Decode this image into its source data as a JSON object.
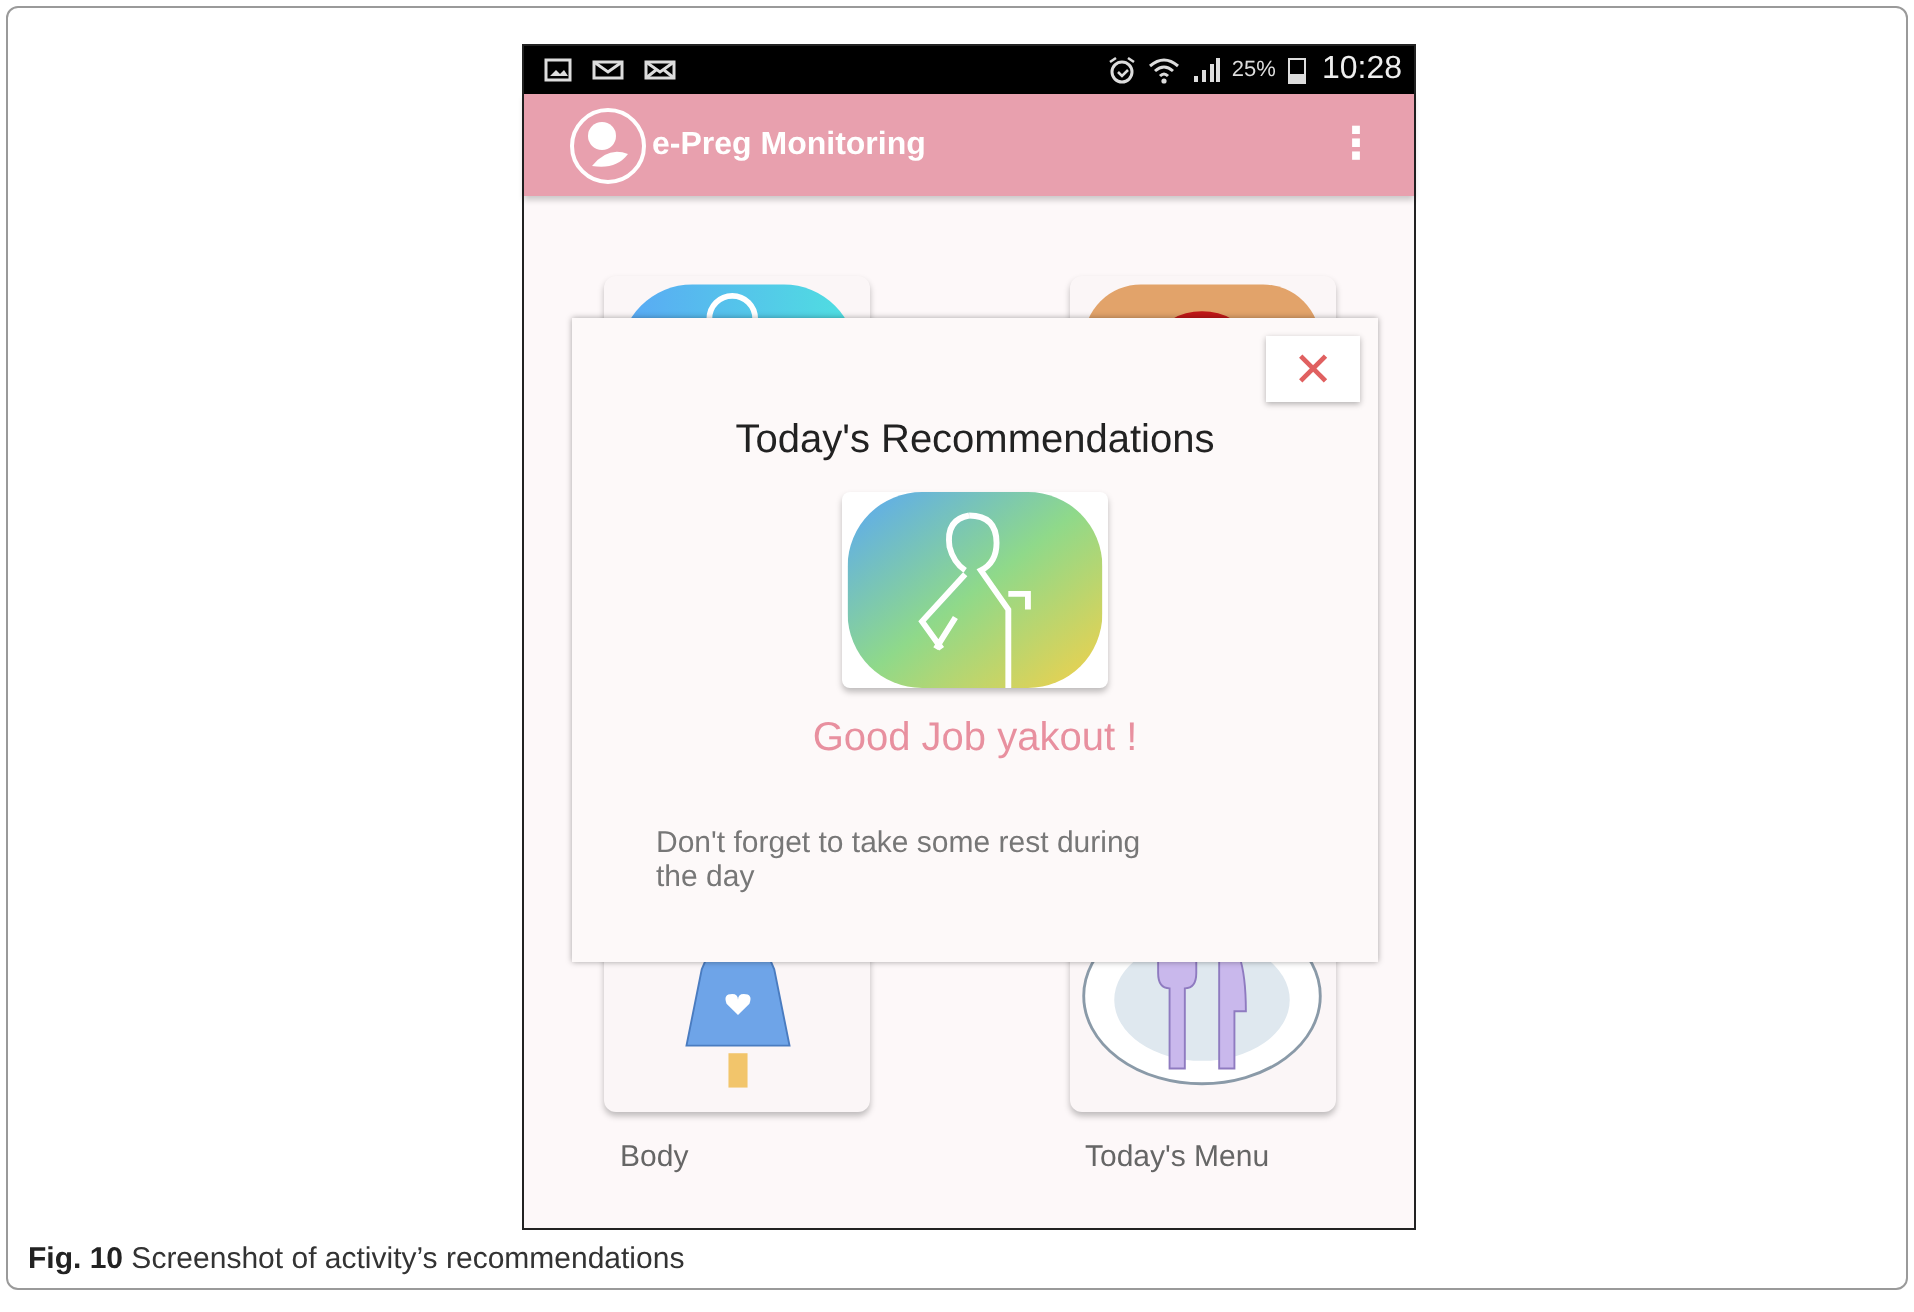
{
  "status_bar": {
    "battery": "25%",
    "time": "10:28"
  },
  "app_bar": {
    "title": "e-Preg Monitoring",
    "menu": "⋮"
  },
  "tiles": [
    {
      "kind": "activity"
    },
    {
      "kind": "red"
    },
    {
      "kind": "body",
      "label": "Body"
    },
    {
      "kind": "menu",
      "label": "Today's Menu"
    }
  ],
  "dialog": {
    "close": "✕",
    "title": "Today's Recommendations",
    "greeting": "Good Job yakout !",
    "message": "Don't forget to take some rest during the day"
  },
  "caption": "**Fig. 10** Screenshot of activity’s recommendations"
}
